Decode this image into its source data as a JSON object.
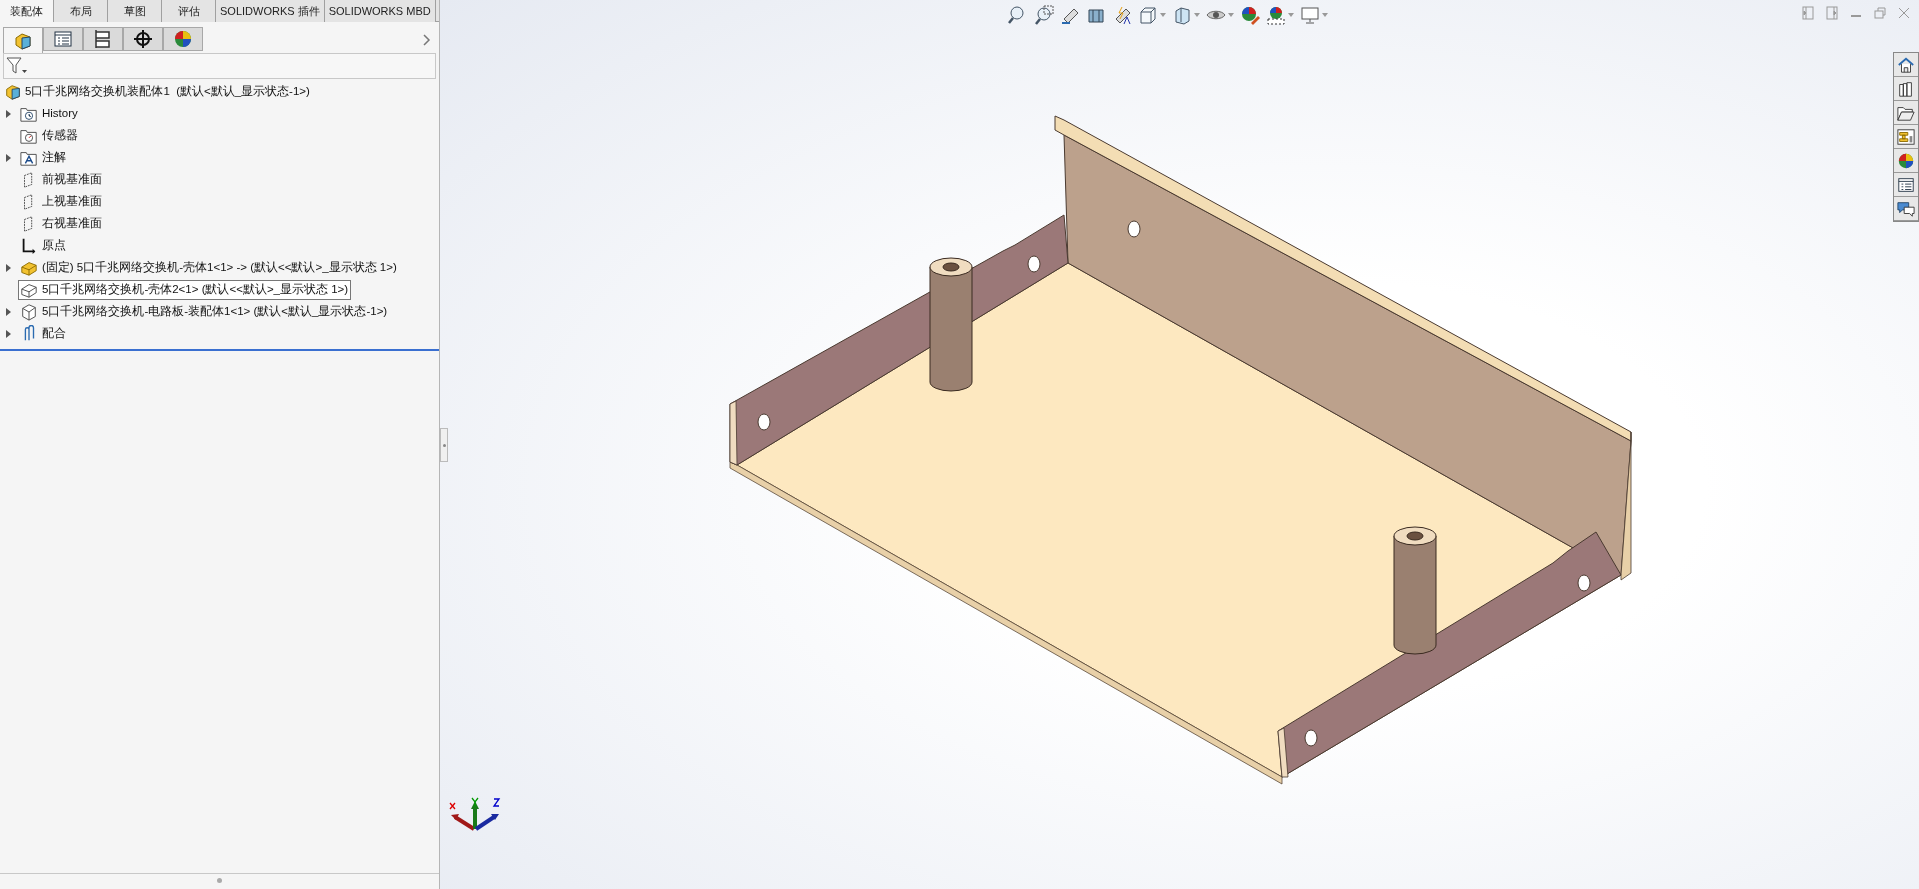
{
  "command_tabs": [
    {
      "label": "装配体",
      "selected": true
    },
    {
      "label": "布局",
      "selected": false
    },
    {
      "label": "草图",
      "selected": false
    },
    {
      "label": "评估",
      "selected": false
    },
    {
      "label": "SOLIDWORKS 插件",
      "selected": false
    },
    {
      "label": "SOLIDWORKS MBD",
      "selected": false
    }
  ],
  "panel_tabs": [
    {
      "kind": "feature-tree",
      "selected": true
    },
    {
      "kind": "property",
      "selected": false
    },
    {
      "kind": "config",
      "selected": false
    },
    {
      "kind": "dimxpert",
      "selected": false
    },
    {
      "kind": "display",
      "selected": false
    }
  ],
  "feature_tree": {
    "root": {
      "label": "5口千兆网络交换机装配体1  (默认<默认_显示状态-1>)",
      "kind": "assembly-root"
    },
    "items": [
      {
        "label": "History",
        "kind": "history",
        "expandable": true,
        "selected": false
      },
      {
        "label": "传感器",
        "kind": "sensor",
        "expandable": false,
        "selected": false
      },
      {
        "label": "注解",
        "kind": "annotation",
        "expandable": true,
        "selected": false
      },
      {
        "label": "前视基准面",
        "kind": "plane",
        "expandable": false,
        "selected": false
      },
      {
        "label": "上视基准面",
        "kind": "plane",
        "expandable": false,
        "selected": false
      },
      {
        "label": "右视基准面",
        "kind": "plane",
        "expandable": false,
        "selected": false
      },
      {
        "label": "原点",
        "kind": "origin",
        "expandable": false,
        "selected": false
      },
      {
        "label": "(固定) 5口千兆网络交换机-壳体1<1> -> (默认<<默认>_显示状态 1>)",
        "kind": "part-fixed",
        "expandable": true,
        "selected": false
      },
      {
        "label": "5口千兆网络交换机-壳体2<1> (默认<<默认>_显示状态 1>)",
        "kind": "part",
        "expandable": false,
        "selected": true
      },
      {
        "label": "5口千兆网络交换机-电路板-装配体1<1> (默认<默认_显示状态-1>)",
        "kind": "assembly",
        "expandable": true,
        "selected": false
      },
      {
        "label": "配合",
        "kind": "mates",
        "expandable": true,
        "selected": false
      }
    ]
  }
}
